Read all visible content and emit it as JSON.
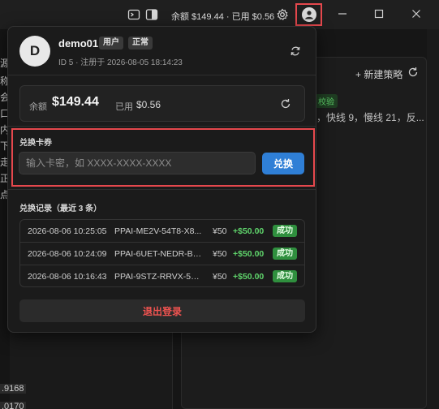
{
  "titlebar": {
    "status": "余额 $149.44 · 已用 $0.56"
  },
  "background": {
    "left_chars": [
      "源",
      "称",
      "会",
      "口",
      "内",
      "下",
      "走",
      "正",
      "点"
    ],
    "new_strategy": "+ 新建策略",
    "verify_badge": "校验",
    "line_text": "，快线 9，慢线 21，反...",
    "bottom_nums": [
      ".9168",
      ".0170"
    ]
  },
  "user": {
    "avatar_letter": "D",
    "name": "demo01",
    "role_badge": "用户",
    "status_badge": "正常",
    "meta": "ID 5 · 注册于 2026-08-05 18:14:23"
  },
  "balance": {
    "balance_label": "余额",
    "balance_value": "$149.44",
    "used_label": "已用",
    "used_value": "$0.56"
  },
  "redeem": {
    "title": "兑换卡券",
    "placeholder": "输入卡密，如 XXXX-XXXX-XXXX",
    "button_label": "兑换"
  },
  "records": {
    "title": "兑换记录（最近 3 条）",
    "rows": [
      {
        "time": "2026-08-06 10:25:05",
        "code": "PPAI-ME2V-54T8-X8...",
        "price": "¥50",
        "amount": "+$50.00",
        "status": "成功"
      },
      {
        "time": "2026-08-06 10:24:09",
        "code": "PPAI-6UET-NEDR-B6...",
        "price": "¥50",
        "amount": "+$50.00",
        "status": "成功"
      },
      {
        "time": "2026-08-06 10:16:43",
        "code": "PPAI-9STZ-RRVX-5Q...",
        "price": "¥50",
        "amount": "+$50.00",
        "status": "成功"
      }
    ]
  },
  "logout_label": "退出登录",
  "colors": {
    "accent": "#2f7fd6",
    "highlight": "#e5484d",
    "success": "#5fd36b",
    "danger": "#ef5350"
  },
  "icons": [
    "terminal-icon",
    "layout-icon",
    "gear-icon",
    "account-icon",
    "minimize-icon",
    "maximize-icon",
    "close-icon",
    "refresh-icon"
  ]
}
